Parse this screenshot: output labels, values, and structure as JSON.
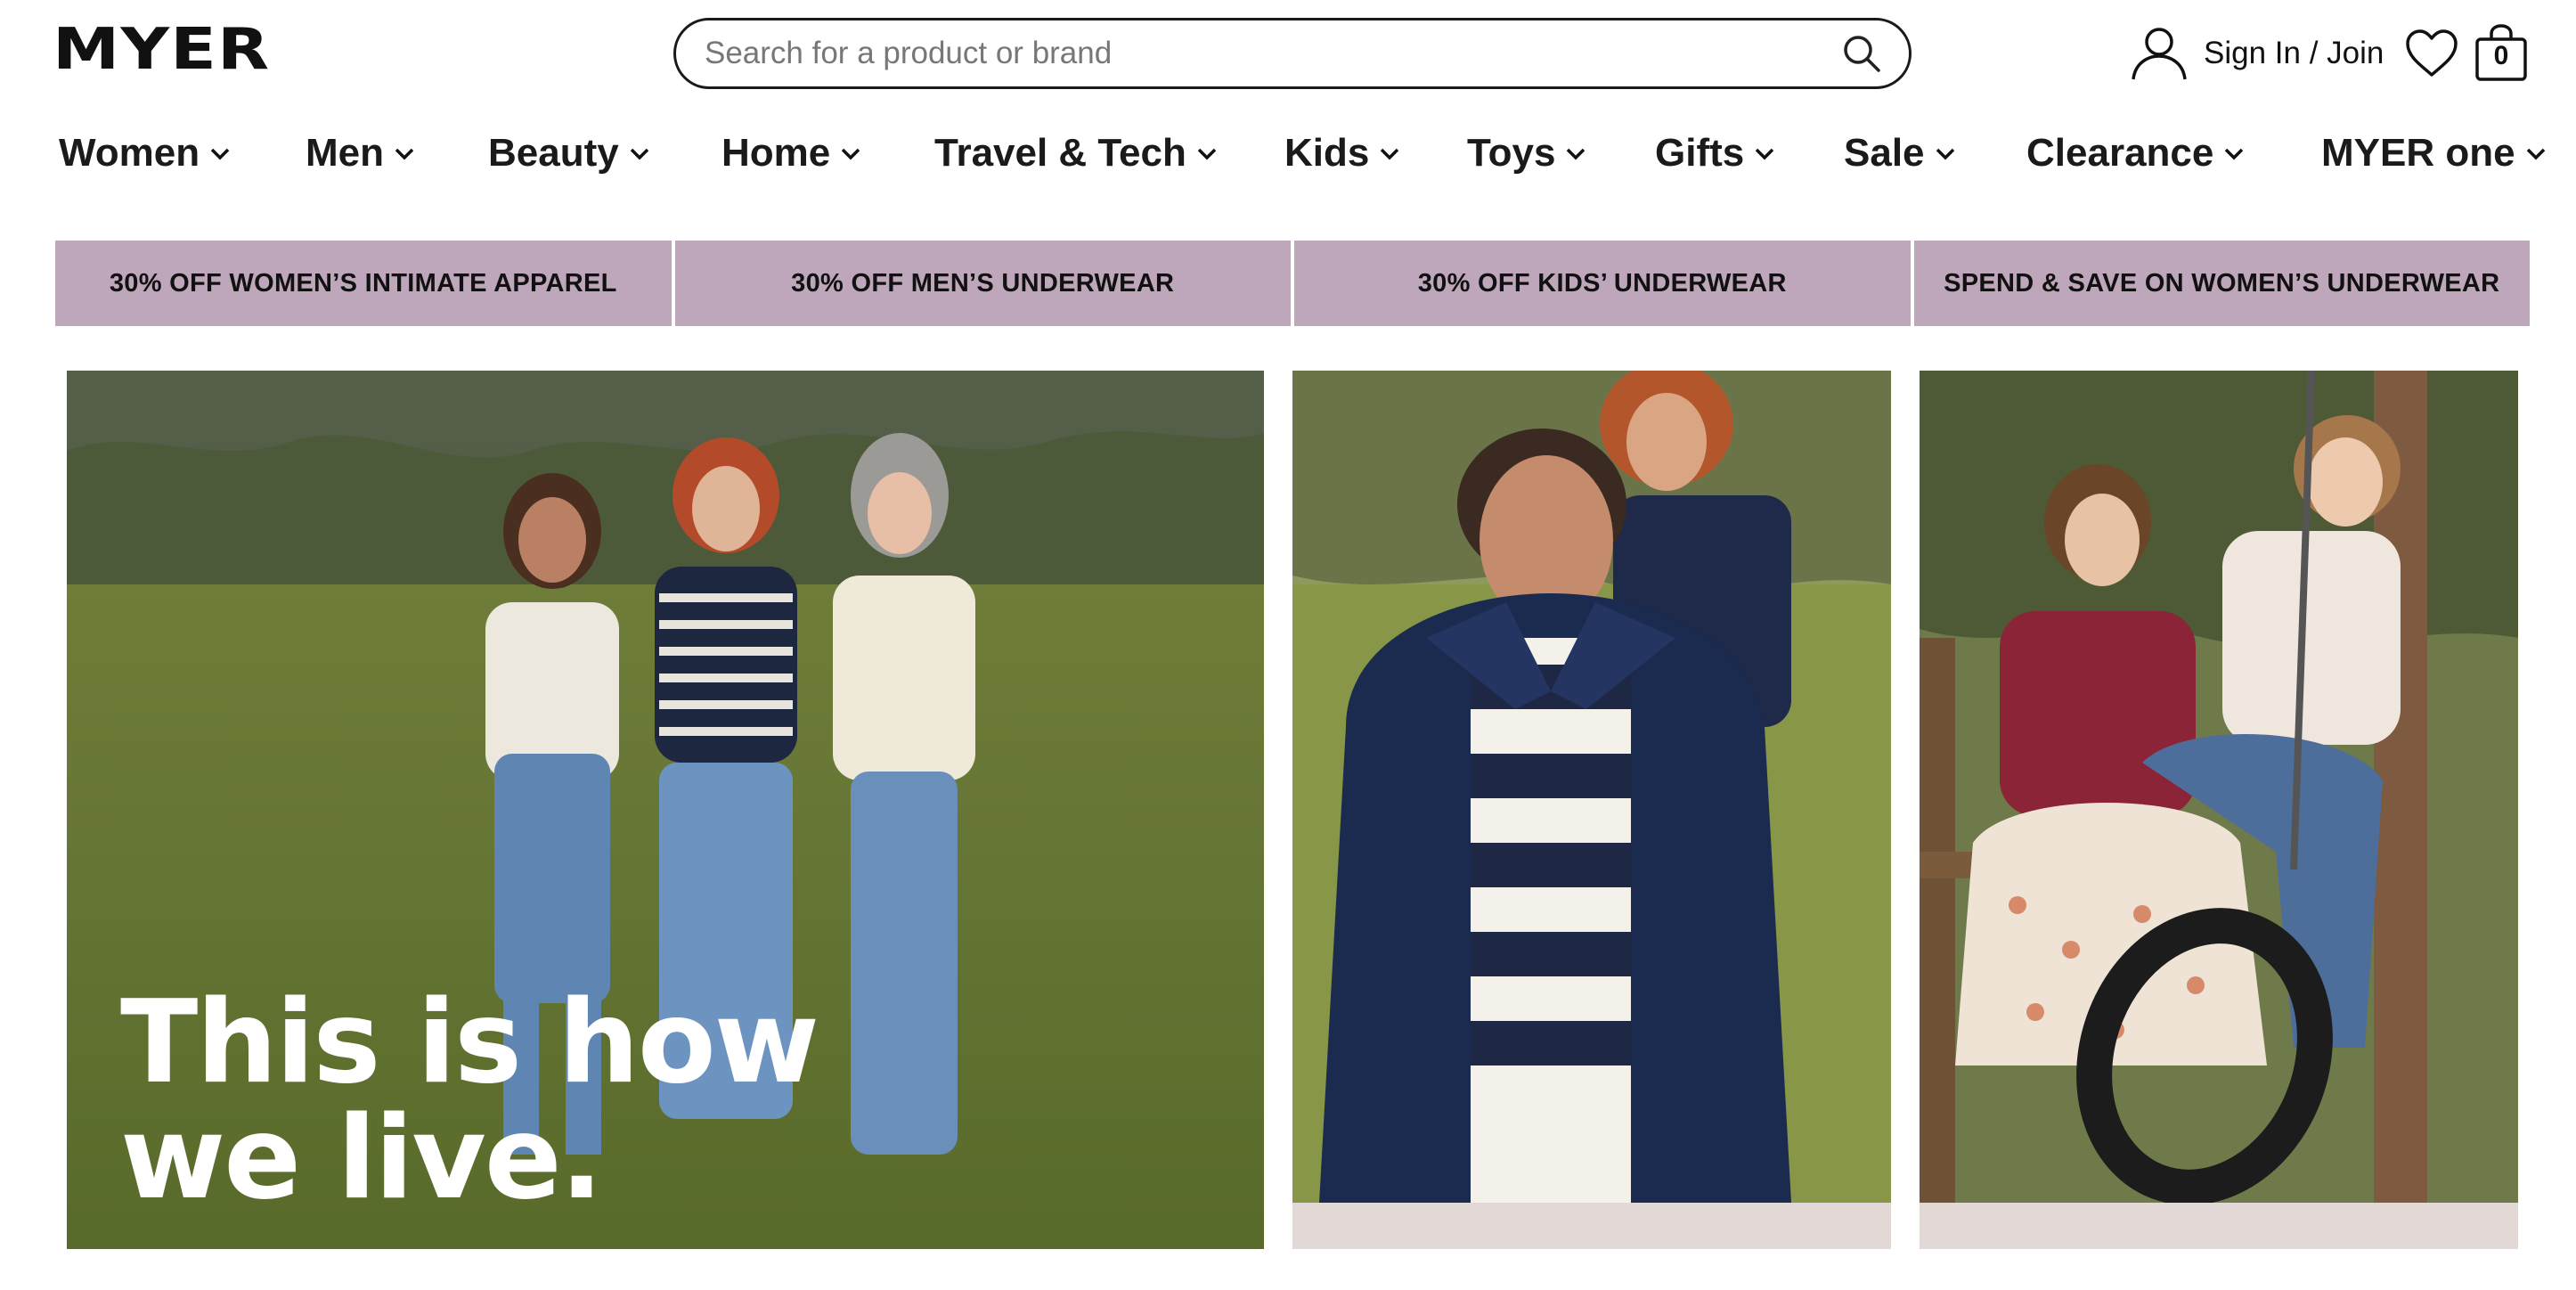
{
  "brand": {
    "logo_text": "MYER"
  },
  "search": {
    "placeholder": "Search for a product or brand",
    "value": "",
    "icon": "search-icon"
  },
  "account": {
    "signin_label": "Sign In / Join",
    "icon": "user-icon"
  },
  "wishlist": {
    "icon": "heart-icon"
  },
  "bag": {
    "count": "0",
    "icon": "shopping-bag-icon"
  },
  "nav": {
    "items": [
      {
        "label": "Women"
      },
      {
        "label": "Men"
      },
      {
        "label": "Beauty"
      },
      {
        "label": "Home"
      },
      {
        "label": "Travel & Tech"
      },
      {
        "label": "Kids"
      },
      {
        "label": "Toys"
      },
      {
        "label": "Gifts"
      },
      {
        "label": "Sale"
      },
      {
        "label": "Clearance"
      },
      {
        "label": "MYER one"
      }
    ]
  },
  "promo": {
    "tiles": [
      {
        "label": "30% OFF WOMEN’S INTIMATE APPAREL"
      },
      {
        "label": "30% OFF MEN’S UNDERWEAR"
      },
      {
        "label": "30% OFF KIDS’ UNDERWEAR"
      },
      {
        "label": "SPEND & SAVE ON WOMEN’S UNDERWEAR"
      }
    ],
    "color": "#bfa7bb"
  },
  "hero": {
    "main_caption_line1": "This is how",
    "main_caption_line2": "we live."
  }
}
